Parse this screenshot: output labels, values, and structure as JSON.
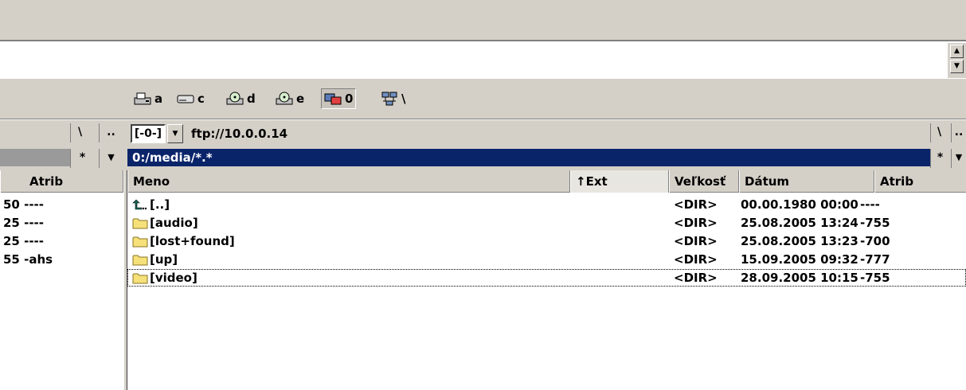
{
  "drives": [
    {
      "letter": "a",
      "icon": "floppy-drive-icon"
    },
    {
      "letter": "c",
      "icon": "hard-drive-icon"
    },
    {
      "letter": "d",
      "icon": "cd-drive-icon"
    },
    {
      "letter": "e",
      "icon": "cd-drive-icon"
    },
    {
      "letter": "0",
      "icon": "ftp-connection-icon",
      "active": true
    },
    {
      "letter": "\\",
      "icon": "network-icon"
    }
  ],
  "left_panel": {
    "root_btn": "\\",
    "up_btn": "..",
    "star_btn": "*",
    "atrib_header": "Atrib",
    "rows": [
      {
        "attr": "50 ----"
      },
      {
        "attr": "25 ----"
      },
      {
        "attr": "25 ----"
      },
      {
        "attr": "55 -ahs"
      }
    ]
  },
  "right_panel": {
    "drive_selector": "[-0-]",
    "path": "ftp://10.0.0.14",
    "current_dir": "0:/media/*.*",
    "root_btn": "\\",
    "up_btn": "..",
    "star_btn": "*",
    "headers": {
      "name": "Meno",
      "ext": "↑Ext",
      "size": "Veľkosť",
      "date": "Dátum",
      "attr": "Atrib"
    },
    "files": [
      {
        "name": "[..]",
        "size": "<DIR>",
        "date": "00.00.1980 00:00",
        "attr": "----",
        "icon": "up-dir-icon"
      },
      {
        "name": "[audio]",
        "size": "<DIR>",
        "date": "25.08.2005 13:24",
        "attr": "-755",
        "icon": "folder-icon"
      },
      {
        "name": "[lost+found]",
        "size": "<DIR>",
        "date": "25.08.2005 13:23",
        "attr": "-700",
        "icon": "folder-icon"
      },
      {
        "name": "[up]",
        "size": "<DIR>",
        "date": "15.09.2005 09:32",
        "attr": "-777",
        "icon": "folder-icon"
      },
      {
        "name": "[video]",
        "size": "<DIR>",
        "date": "28.09.2005 10:15",
        "attr": "-755",
        "icon": "folder-icon",
        "focused": true
      }
    ]
  },
  "colors": {
    "chrome": "#d4d0c8",
    "selection": "#0a246a",
    "folder": "#f5e07a"
  }
}
